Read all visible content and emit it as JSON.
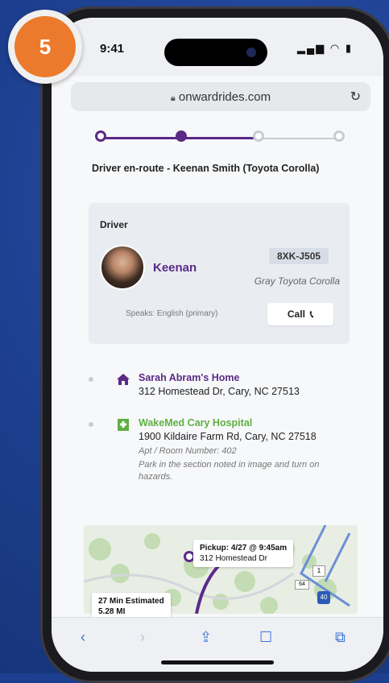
{
  "step_badge": "5",
  "status_bar": {
    "time": "9:41",
    "signal_icon": "signal-icon",
    "wifi_icon": "wifi-icon",
    "battery_icon": "battery-icon"
  },
  "browser": {
    "url": "onwardrides.com",
    "lock_icon": "lock-icon",
    "reload_icon": "reload-icon"
  },
  "trip": {
    "status": "Driver en-route - Keenan Smith (Toyota Corolla)",
    "progress_steps": 4,
    "completed_steps": 2
  },
  "driver_card": {
    "heading": "Driver",
    "name": "Keenan",
    "plate": "8XK-J505",
    "vehicle": "Gray Toyota Corolla",
    "speaks": "Speaks: English (primary)",
    "call_label": "Call"
  },
  "stops": [
    {
      "name": "Sarah Abram's Home",
      "address": "312 Homestead Dr, Cary, NC 27513",
      "icon": "home-icon",
      "color": "#5b2a86"
    },
    {
      "name": "WakeMed Cary Hospital",
      "address": "1900 Kildaire Farm Rd, Cary, NC 27518",
      "icon": "hospital-icon",
      "color": "#5fb043",
      "apt": "Apt / Room Number: 402",
      "note": "Park in the section noted in image and turn on hazards."
    }
  ],
  "map": {
    "pickup_title": "Pickup: 4/27 @ 9:45am",
    "pickup_address": "312 Homestead Dr",
    "eta": "27 Min Estimated",
    "distance": "5.28 MI",
    "route_shield_1": "1",
    "route_shield_64": "64",
    "route_shield_40": "40"
  },
  "colors": {
    "brand_purple": "#5b2a86",
    "hospital_green": "#5fb043",
    "badge_orange": "#ec7a2d",
    "ios_blue": "#3a72d8"
  }
}
